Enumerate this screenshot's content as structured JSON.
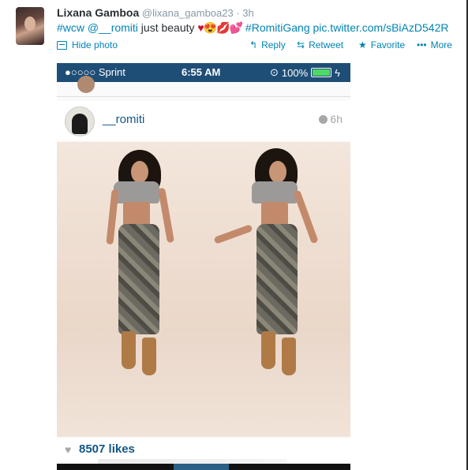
{
  "tweet": {
    "name": "Lixana Gamboa",
    "handle": "@lixana_gamboa23",
    "time": "· 3h",
    "hashtag_wcw": "#wcw",
    "mention": "@__romiti",
    "text": " just beauty ",
    "emoji": "♥😍💋💕",
    "hashtag_gang": "#RomitiGang",
    "pic_link": "pic.twitter.com/sBiAzD542R",
    "hide_photo": "Hide photo",
    "reply": "Reply",
    "retweet": "Retweet",
    "favorite": "Favorite",
    "more": "More"
  },
  "icons": {
    "reply": "reply-arrow-icon",
    "retweet": "retweet-icon",
    "favorite": "star-icon",
    "more": "more-dots-icon",
    "hide_photo": "photo-icon"
  },
  "phone": {
    "carrier": "●○○○○ Sprint",
    "clock": "6:55 AM",
    "battery": "100%",
    "username": "__romiti",
    "posted": "6h",
    "likes": "8507 likes"
  },
  "colors": {
    "link": "#0084b4",
    "status_bar": "#1e4e76",
    "instagram_blue": "#125688"
  }
}
